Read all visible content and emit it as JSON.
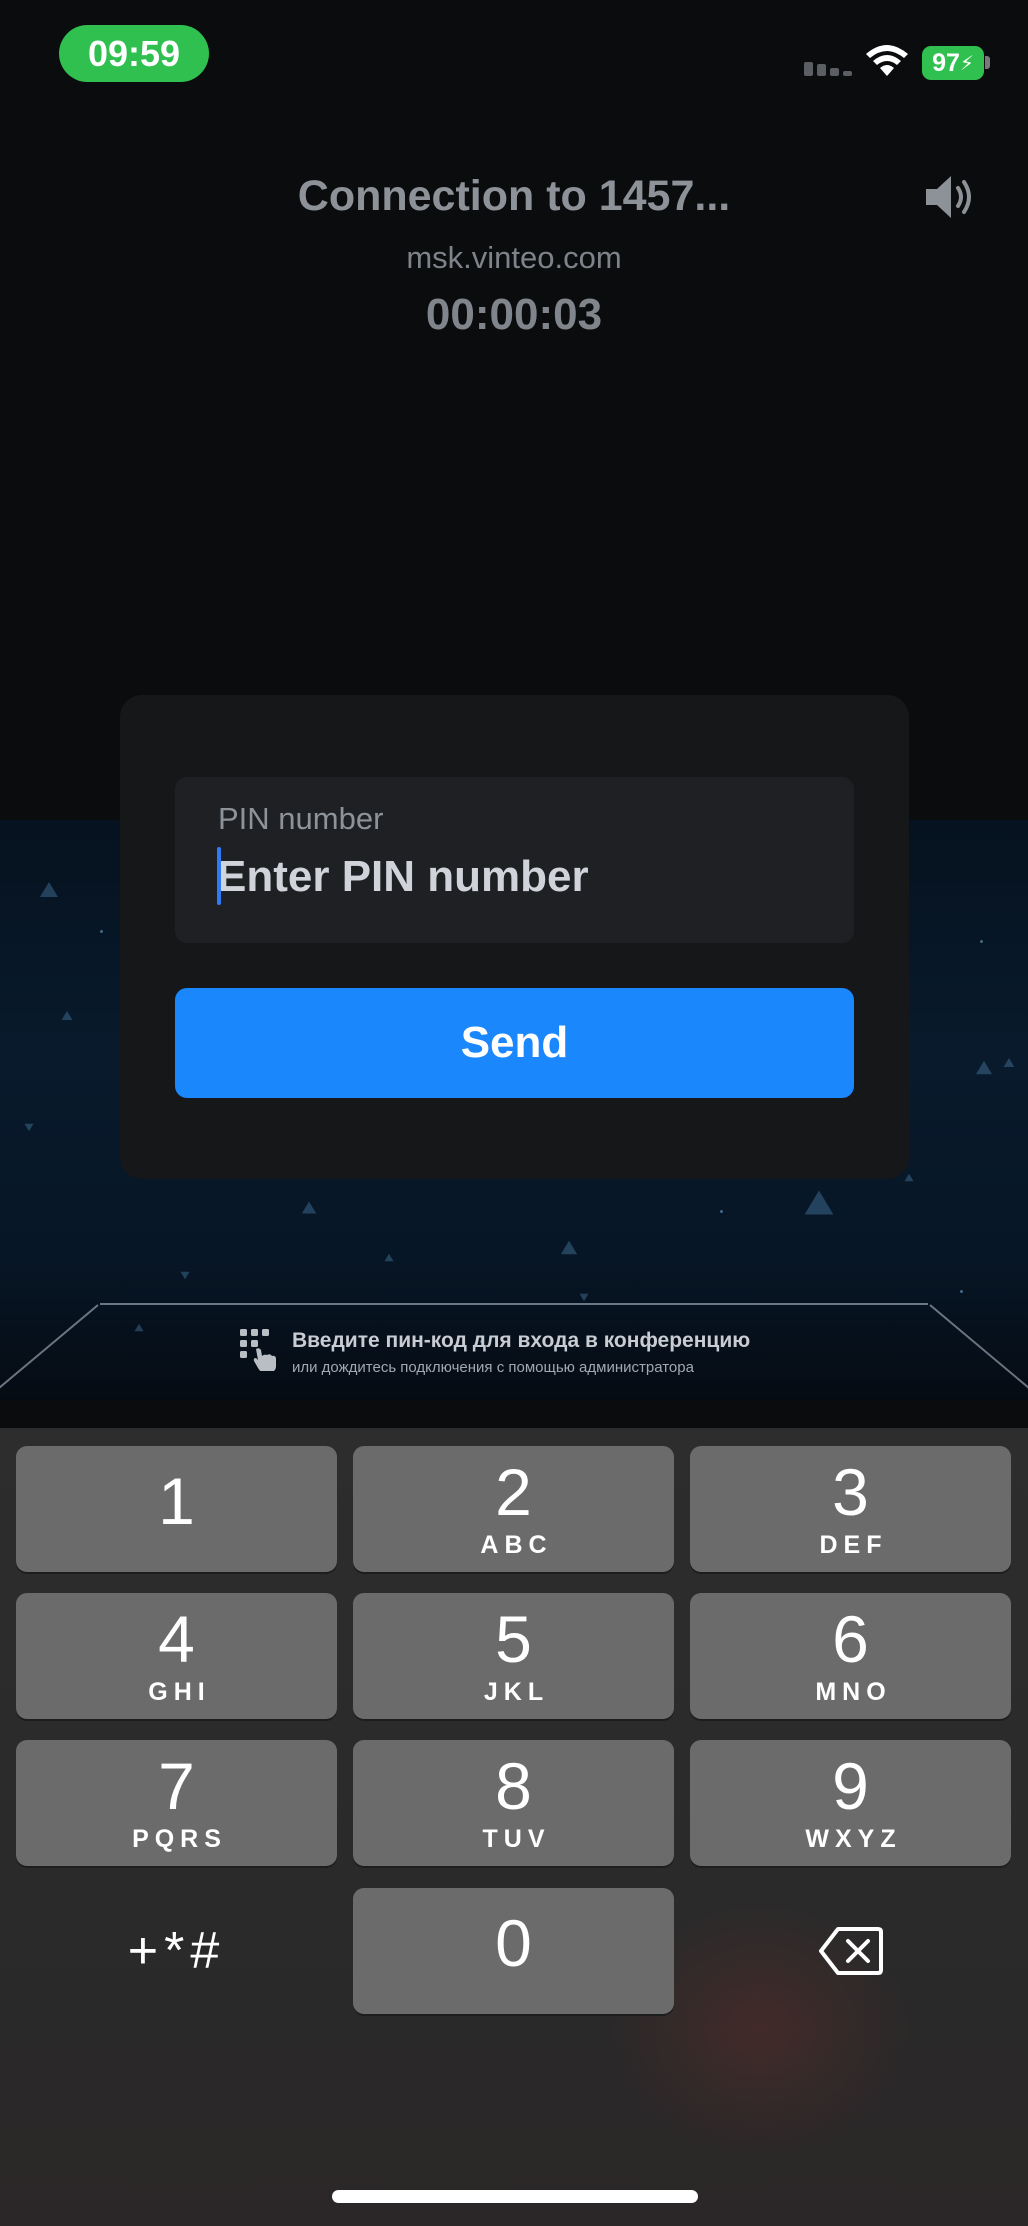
{
  "status_bar": {
    "time": "09:59",
    "battery": "97",
    "battery_color": "#30c04f",
    "icons": [
      "signal-icon",
      "wifi-icon",
      "battery-icon"
    ]
  },
  "call": {
    "title": "Connection to 1457...",
    "domain": "msk.vinteo.com",
    "timer": "00:00:03",
    "speaker_icon": "speaker-icon"
  },
  "pin_dialog": {
    "label": "PIN number",
    "placeholder": "Enter PIN number",
    "value": "",
    "send_label": "Send",
    "accent_color": "#1a87fd"
  },
  "banner": {
    "title": "Введите пин-код для входа в конференцию",
    "subtitle": "или дождитесь подключения с помощью администратора",
    "icon": "keypad-touch-icon"
  },
  "keypad": {
    "keys": [
      {
        "digit": "1",
        "letters": ""
      },
      {
        "digit": "2",
        "letters": "ABC"
      },
      {
        "digit": "3",
        "letters": "DEF"
      },
      {
        "digit": "4",
        "letters": "GHI"
      },
      {
        "digit": "5",
        "letters": "JKL"
      },
      {
        "digit": "6",
        "letters": "MNO"
      },
      {
        "digit": "7",
        "letters": "PQRS"
      },
      {
        "digit": "8",
        "letters": "TUV"
      },
      {
        "digit": "9",
        "letters": "WXYZ"
      },
      {
        "digit": "0",
        "letters": ""
      }
    ],
    "symbols_label": "+*#",
    "delete_icon": "backspace-icon"
  }
}
